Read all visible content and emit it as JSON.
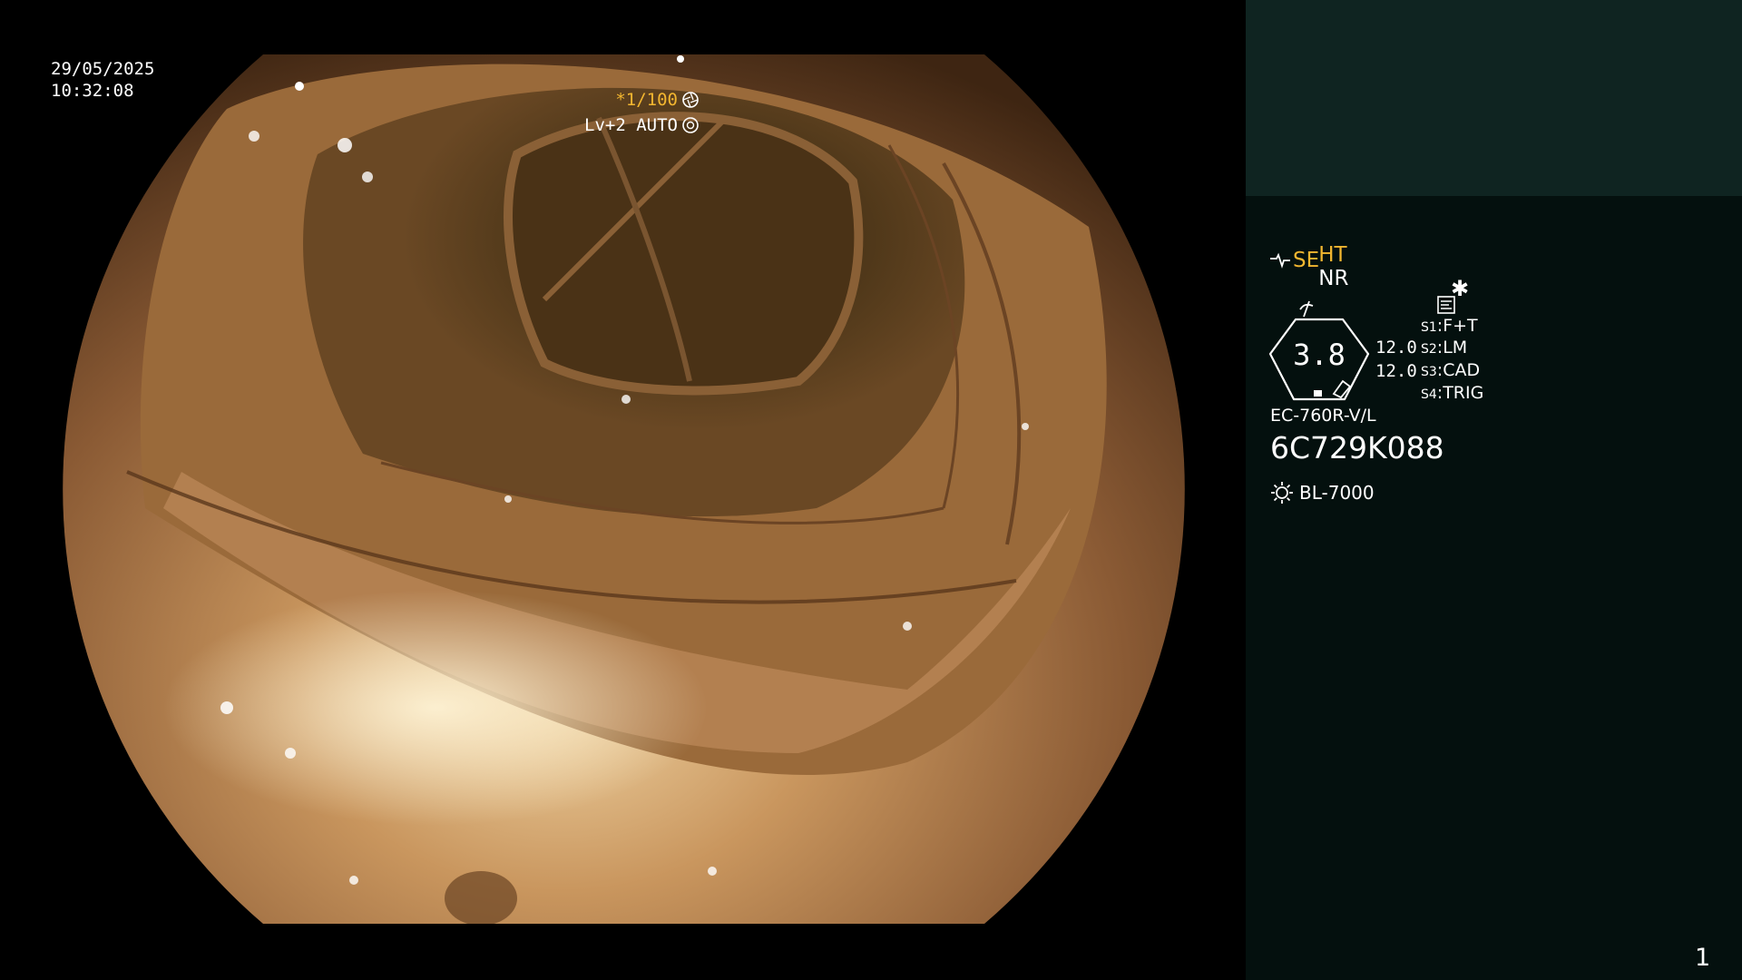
{
  "overlay": {
    "date": "29/05/2025",
    "time": "10:32:08",
    "shutter": "*1/100",
    "enhancement": "Lv+2 AUTO"
  },
  "panel": {
    "mode_ht": "HT",
    "mode_nr": "NR",
    "structure_enhance": "SE",
    "zoom": "3.8",
    "value_1": "12.0",
    "value_2": "12.0",
    "switches": [
      {
        "key": "S1",
        "label": "F+T"
      },
      {
        "key": "S2",
        "label": "LM"
      },
      {
        "key": "S3",
        "label": "CAD"
      },
      {
        "key": "S4",
        "label": "TRIG"
      }
    ],
    "scope_model": "EC-760R-V/L",
    "scope_serial": "6C729K088",
    "light_source": "BL-7000",
    "page_number": "1"
  },
  "colors": {
    "accent_yellow": "#f2b630",
    "panel_bg": "#04100e",
    "panel_top_bg": "#0f2421"
  }
}
